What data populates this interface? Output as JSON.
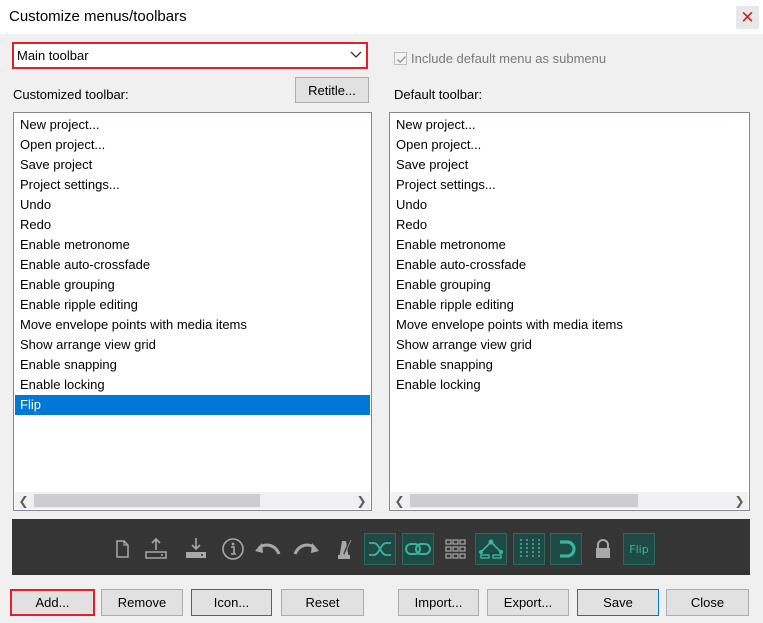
{
  "window": {
    "title": "Customize menus/toolbars"
  },
  "dropdown": {
    "selected": "Main toolbar"
  },
  "include_default": {
    "label": "Include default menu as submenu",
    "checked": true
  },
  "buttons": {
    "retitle": "Retitle...",
    "add": "Add...",
    "remove": "Remove",
    "icon": "Icon...",
    "reset": "Reset",
    "import": "Import...",
    "export": "Export...",
    "save": "Save",
    "close": "Close"
  },
  "customized": {
    "label": "Customized toolbar:",
    "items": [
      "New project...",
      "Open project...",
      "Save project",
      "Project settings...",
      "Undo",
      "Redo",
      "Enable metronome",
      "Enable auto-crossfade",
      "Enable grouping",
      "Enable ripple editing",
      "Move envelope points with media items",
      "Show arrange view grid",
      "Enable snapping",
      "Enable locking",
      "Flip"
    ],
    "selected_index": 14
  },
  "default": {
    "label": "Default toolbar:",
    "items": [
      "New project...",
      "Open project...",
      "Save project",
      "Project settings...",
      "Undo",
      "Redo",
      "Enable metronome",
      "Enable auto-crossfade",
      "Enable grouping",
      "Enable ripple editing",
      "Move envelope points with media items",
      "Show arrange view grid",
      "Enable snapping",
      "Enable locking"
    ]
  },
  "toolbar_preview": {
    "icons": [
      {
        "name": "new-project-icon",
        "active": false
      },
      {
        "name": "open-project-icon",
        "active": false
      },
      {
        "name": "save-project-icon",
        "active": false
      },
      {
        "name": "project-settings-icon",
        "active": false
      },
      {
        "name": "undo-icon",
        "active": false
      },
      {
        "name": "redo-icon",
        "active": false
      },
      {
        "name": "metronome-icon",
        "active": false
      },
      {
        "name": "auto-crossfade-icon",
        "active": true
      },
      {
        "name": "grouping-icon",
        "active": true
      },
      {
        "name": "ripple-editing-icon",
        "active": false
      },
      {
        "name": "envelope-points-icon",
        "active": true
      },
      {
        "name": "grid-icon",
        "active": true
      },
      {
        "name": "snapping-icon",
        "active": true
      },
      {
        "name": "locking-icon",
        "active": false
      },
      {
        "name": "flip-icon",
        "active": false
      }
    ],
    "flip_label": "Flip"
  },
  "colors": {
    "selection": "#0078d7",
    "highlight_red": "#e0202a",
    "toolbar_bg": "#353535",
    "icon_active": "#3ab3a1"
  }
}
